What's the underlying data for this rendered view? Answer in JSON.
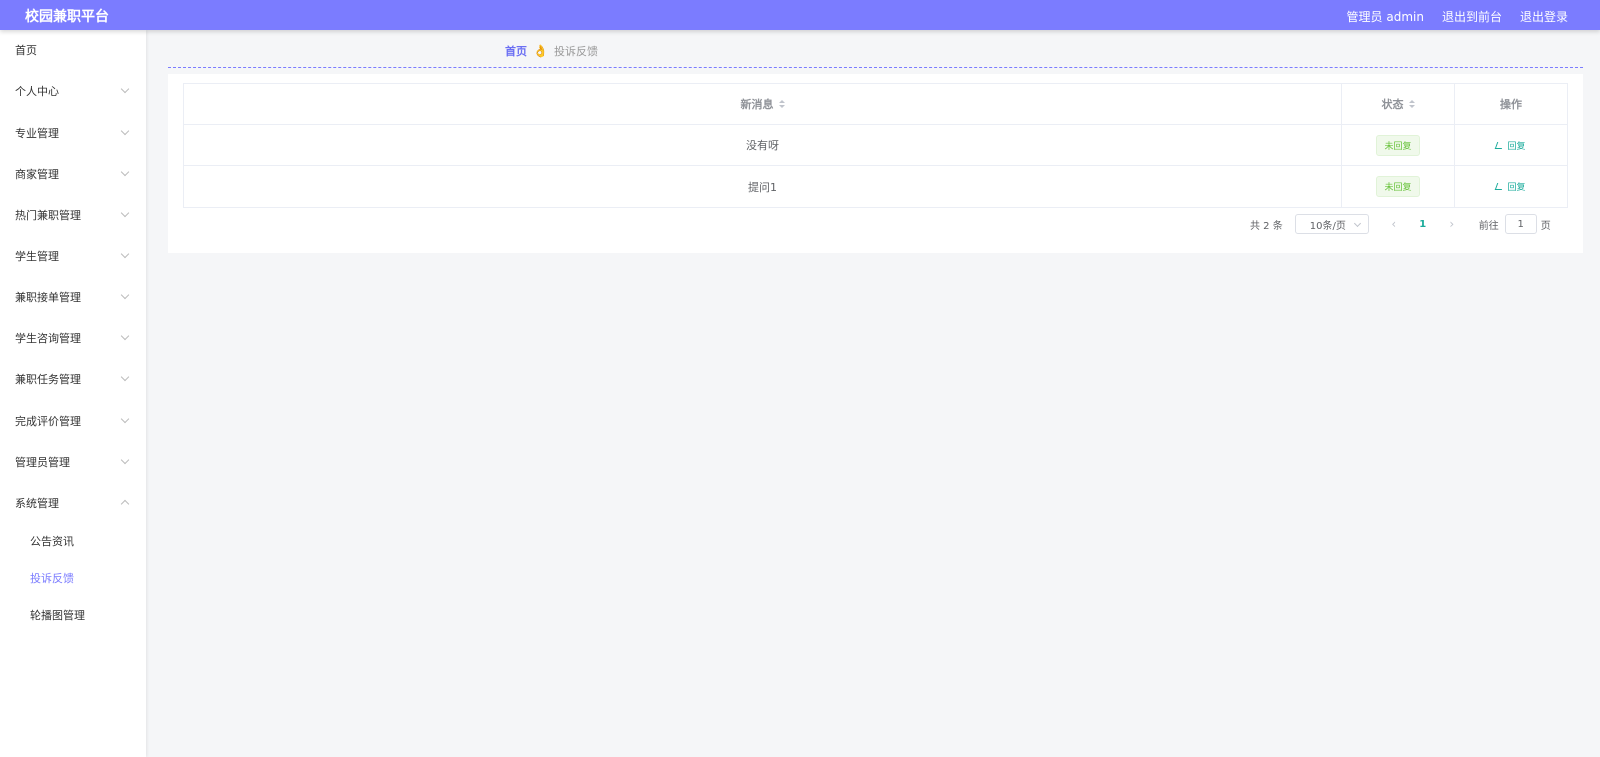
{
  "header": {
    "title": "校园兼职平台",
    "admin_label": "管理员 admin",
    "goto_front": "退出到前台",
    "logout": "退出登录"
  },
  "sidebar": {
    "items": [
      {
        "label": "首页"
      },
      {
        "label": "个人中心"
      },
      {
        "label": "专业管理"
      },
      {
        "label": "商家管理"
      },
      {
        "label": "热门兼职管理"
      },
      {
        "label": "学生管理"
      },
      {
        "label": "兼职接单管理"
      },
      {
        "label": "学生咨询管理"
      },
      {
        "label": "兼职任务管理"
      },
      {
        "label": "完成评价管理"
      },
      {
        "label": "管理员管理"
      },
      {
        "label": "系统管理"
      }
    ],
    "subitems": [
      {
        "label": "公告资讯"
      },
      {
        "label": "投诉反馈"
      },
      {
        "label": "轮播图管理"
      }
    ]
  },
  "breadcrumb": {
    "home": "首页",
    "separator": "👌",
    "current": "投诉反馈"
  },
  "table": {
    "columns": [
      "新消息",
      "状态",
      "操作"
    ],
    "rows": [
      {
        "message": "没有呀",
        "status": "未回复",
        "action": "回复"
      },
      {
        "message": "提问1",
        "status": "未回复",
        "action": "回复"
      }
    ]
  },
  "pagination": {
    "total": "共 2 条",
    "page_size": "10条/页",
    "current_page": "1",
    "goto_label": "前往",
    "goto_value": "1",
    "page_suffix": "页"
  },
  "colors": {
    "accent": "#7b7cff",
    "success": "#67c23a",
    "teal": "#1aab9b"
  }
}
